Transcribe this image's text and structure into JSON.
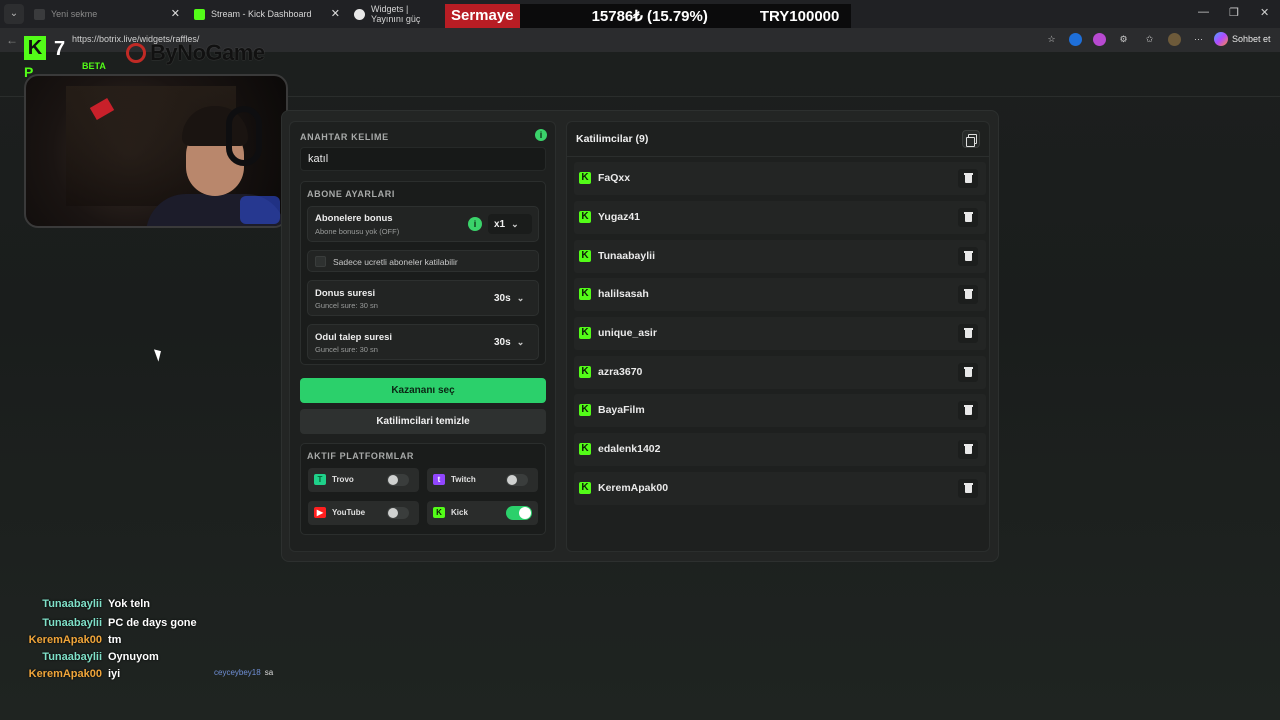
{
  "browser": {
    "tabs": [
      {
        "label": "Yeni sekme"
      },
      {
        "label": "Stream - Kick Dashboard"
      },
      {
        "label": "Widgets | Yayınını güç"
      }
    ],
    "url": "https://botrix.live/widgets/raffles/",
    "chat_button": "Sohbet et"
  },
  "ticker": {
    "label": "Sermaye",
    "value": "15786₺ (15.79%)",
    "capital": "TRY100000"
  },
  "overlay": {
    "beta": "BETA",
    "sponsor": "ByNoGame",
    "logo_number": "7",
    "logo_k": "K",
    "logo_p": "P"
  },
  "chat": [
    {
      "user": "Tunaabaylii",
      "message": "Yok teln",
      "color": "#7fe0c8"
    },
    {
      "user": "Tunaabaylii",
      "message": "PC de days gone",
      "color": "#7fe0c8"
    },
    {
      "user": "KeremApak00",
      "message": "tm",
      "color": "#f0a53a"
    },
    {
      "user": "Tunaabaylii",
      "message": "Oynuyom",
      "color": "#7fe0c8"
    },
    {
      "user": "KeremApak00",
      "message": "iyi",
      "color": "#f0a53a"
    }
  ],
  "chat_extra": {
    "user": "ceyceybey18",
    "message": "sa"
  },
  "raffle": {
    "keyword_label": "ANAHTAR KELIME",
    "keyword_value": "katıl",
    "sub_settings_label": "ABONE AYARLARI",
    "sub_bonus_title": "Abonelere bonus",
    "sub_bonus_sub": "Abone bonusu yok (OFF)",
    "sub_bonus_value": "x1",
    "paid_only_label": "Sadece ucretli aboneler katilabilir",
    "bonus_time_title": "Donus suresi",
    "bonus_time_sub": "Guncel sure: 30 sn",
    "bonus_time_value": "30s",
    "claim_time_title": "Odul talep suresi",
    "claim_time_sub": "Guncel sure: 30 sn",
    "claim_time_value": "30s",
    "pick_winner": "Kazananı seç",
    "clear_participants": "Katilimcilari temizle",
    "platforms_label": "AKTIF PLATFORMLAR",
    "platforms": [
      {
        "name": "Trovo",
        "enabled": false,
        "color": "#1fd18a"
      },
      {
        "name": "Twitch",
        "enabled": false,
        "color": "#9146ff"
      },
      {
        "name": "YouTube",
        "enabled": false,
        "color": "#ff1f1f"
      },
      {
        "name": "Kick",
        "enabled": true,
        "color": "#53fc18"
      }
    ]
  },
  "participants": {
    "title": "Katilimcilar (9)",
    "list": [
      "FaQxx",
      "Yugaz41",
      "Tunaabaylii",
      "halilsasah",
      "unique_asir",
      "azra3670",
      "BayaFilm",
      "edalenk1402",
      "KeremApak00"
    ]
  },
  "colors": {
    "accent": "#2bd06b",
    "kick": "#53fc18",
    "ticker_red": "#b81d24"
  }
}
